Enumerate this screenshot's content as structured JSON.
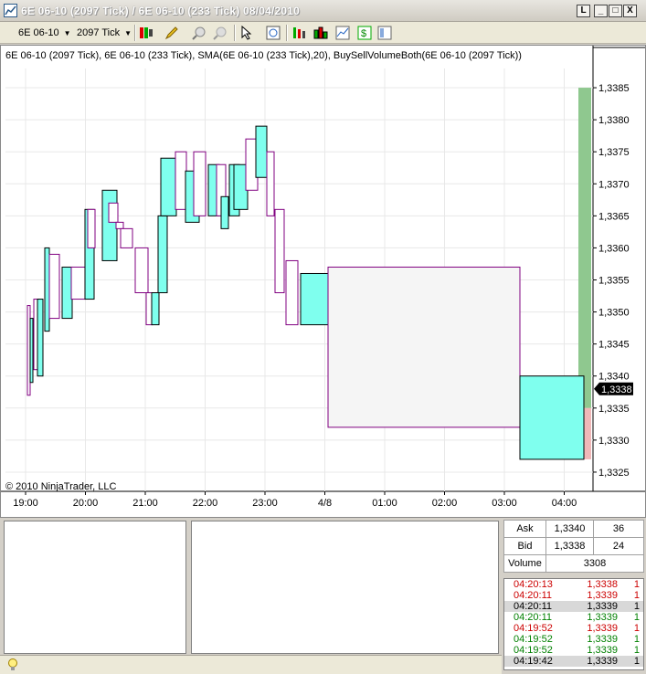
{
  "window": {
    "title": "6E 06-10 (2097 Tick) / 6E 06-10 (233 Tick)  08/04/2010",
    "buttons": {
      "link": "L",
      "minimize": "_",
      "maximize": "□",
      "close": "X"
    }
  },
  "toolbar": {
    "instrument": "6E 06-10",
    "interval": "2097 Tick",
    "icons": [
      "bar-type-icon",
      "drawing-pencil-icon",
      "zoom-in-icon",
      "zoom-out-icon",
      "cursor-pointer-icon",
      "crosshair-icon",
      "chart-properties-icon",
      "bar-chart-icon",
      "data-box-icon",
      "dollar-icon",
      "strategy-icon"
    ]
  },
  "chart": {
    "info_line": "6E 06-10 (2097 Tick), 6E 06-10 (233 Tick), SMA(6E 06-10 (233 Tick),20), BuySellVolumeBoth(6E 06-10 (2097 Tick))",
    "copyright": "© 2010 NinjaTrader, LLC",
    "last_price_label": "1,3338",
    "colors": {
      "up": "#7fffee",
      "down_fill": "#ffffff",
      "down_outline": "#800080",
      "volume": "#8fc88f",
      "volume_sell": "#f0b8b8"
    }
  },
  "chart_data": {
    "type": "candlestick",
    "y_ticks": [
      "1,3385",
      "1,3380",
      "1,3375",
      "1,3370",
      "1,3365",
      "1,3360",
      "1,3355",
      "1,3350",
      "1,3345",
      "1,3340",
      "1,3335",
      "1,3330",
      "1,3325"
    ],
    "x_ticks": [
      "19:00",
      "20:00",
      "21:00",
      "22:00",
      "23:00",
      "4/8",
      "01:00",
      "02:00",
      "03:00",
      "04:00"
    ],
    "ylim": [
      1.3322,
      1.3388
    ],
    "candles": [
      {
        "t": 0.0,
        "open": 1.3351,
        "close": 1.3337,
        "high": 1.3352,
        "low": 1.3337
      },
      {
        "t": 0.3,
        "open": 1.3339,
        "close": 1.3349,
        "high": 1.335,
        "low": 1.3339
      },
      {
        "t": 0.5,
        "open": 1.3352,
        "close": 1.3341,
        "high": 1.3352,
        "low": 1.334
      },
      {
        "t": 0.7,
        "open": 1.334,
        "close": 1.3352,
        "high": 1.3352,
        "low": 1.334
      },
      {
        "t": 1.1,
        "open": 1.3347,
        "close": 1.336,
        "high": 1.336,
        "low": 1.3347
      },
      {
        "t": 1.6,
        "open": 1.3359,
        "close": 1.3349,
        "high": 1.3359,
        "low": 1.3349
      },
      {
        "t": 2.1,
        "open": 1.3349,
        "close": 1.3357,
        "high": 1.3357,
        "low": 1.3349
      },
      {
        "t": 2.6,
        "open": 1.3357,
        "close": 1.3352,
        "high": 1.3357,
        "low": 1.3352
      },
      {
        "t": 3.1,
        "open": 1.3352,
        "close": 1.3366,
        "high": 1.3366,
        "low": 1.3352
      },
      {
        "t": 3.6,
        "open": 1.3366,
        "close": 1.336,
        "high": 1.3366,
        "low": 1.3358
      },
      {
        "t": 4.1,
        "open": 1.3358,
        "close": 1.3369,
        "high": 1.3369,
        "low": 1.3358
      },
      {
        "t": 4.6,
        "open": 1.3367,
        "close": 1.3364,
        "high": 1.3367,
        "low": 1.3364
      },
      {
        "t": 5.1,
        "open": 1.3364,
        "close": 1.3363,
        "high": 1.3364,
        "low": 1.3357
      },
      {
        "t": 5.6,
        "open": 1.3363,
        "close": 1.336,
        "high": 1.3364,
        "low": 1.3359
      },
      {
        "t": 6.1,
        "open": 1.336,
        "close": 1.3353,
        "high": 1.3363,
        "low": 1.3353
      },
      {
        "t": 6.6,
        "open": 1.3353,
        "close": 1.3348,
        "high": 1.3353,
        "low": 1.3348
      },
      {
        "t": 7.1,
        "open": 1.3348,
        "close": 1.3353,
        "high": 1.3353,
        "low": 1.3348
      },
      {
        "t": 7.6,
        "open": 1.3353,
        "close": 1.3365,
        "high": 1.3365,
        "low": 1.3353
      },
      {
        "t": 8.1,
        "open": 1.3365,
        "close": 1.3374,
        "high": 1.3375,
        "low": 1.3365
      },
      {
        "t": 8.6,
        "open": 1.3375,
        "close": 1.3366,
        "high": 1.3375,
        "low": 1.3366
      },
      {
        "t": 9.1,
        "open": 1.3364,
        "close": 1.3372,
        "high": 1.3372,
        "low": 1.3364
      },
      {
        "t": 9.6,
        "open": 1.3375,
        "close": 1.3365,
        "high": 1.3375,
        "low": 1.3365
      },
      {
        "t": 10.1,
        "open": 1.3365,
        "close": 1.3373,
        "high": 1.3373,
        "low": 1.3365
      },
      {
        "t": 10.6,
        "open": 1.3373,
        "close": 1.3365,
        "high": 1.3373,
        "low": 1.3363
      },
      {
        "t": 11.1,
        "open": 1.3363,
        "close": 1.3368,
        "high": 1.3368,
        "low": 1.3363
      },
      {
        "t": 11.5,
        "open": 1.3365,
        "close": 1.3373,
        "high": 1.3373,
        "low": 1.3365
      },
      {
        "t": 11.9,
        "open": 1.3366,
        "close": 1.3373,
        "high": 1.3373,
        "low": 1.3366
      },
      {
        "t": 12.4,
        "open": 1.3377,
        "close": 1.3369,
        "high": 1.3377,
        "low": 1.3369
      },
      {
        "t": 12.9,
        "open": 1.3371,
        "close": 1.3379,
        "high": 1.3379,
        "low": 1.3371
      },
      {
        "t": 13.4,
        "open": 1.3375,
        "close": 1.3365,
        "high": 1.3375,
        "low": 1.3365
      },
      {
        "t": 13.8,
        "open": 1.3366,
        "close": 1.3353,
        "high": 1.3366,
        "low": 1.3353
      },
      {
        "t": 14.4,
        "open": 1.3358,
        "close": 1.3348,
        "high": 1.3358,
        "low": 1.3348
      },
      {
        "t": 15.0,
        "open": 1.3348,
        "close": 1.3356,
        "high": 1.3356,
        "low": 1.3348
      },
      {
        "t": 16.0,
        "open": 1.3357,
        "close": 1.3332,
        "high": 1.3357,
        "low": 1.3332
      },
      {
        "t": 22.0,
        "open": 1.3327,
        "close": 1.334,
        "high": 1.334,
        "low": 1.3327
      }
    ],
    "volume_bar": {
      "buy_top": 1.3385,
      "sell_top": 1.3335
    }
  },
  "quote": {
    "ask_label": "Ask",
    "ask_price": "1,3340",
    "ask_size": "36",
    "bid_label": "Bid",
    "bid_price": "1,3338",
    "bid_size": "24",
    "volume_label": "Volume",
    "volume_value": "3308"
  },
  "time_sales": [
    {
      "time": "04:20:13",
      "price": "1,3338",
      "size": "1",
      "color": "#cc0000",
      "bg": "#ffffff"
    },
    {
      "time": "04:20:11",
      "price": "1,3339",
      "size": "1",
      "color": "#cc0000",
      "bg": "#ffffff"
    },
    {
      "time": "04:20:11",
      "price": "1,3339",
      "size": "1",
      "color": "#000000",
      "bg": "#d8d8d8"
    },
    {
      "time": "04:20:11",
      "price": "1,3339",
      "size": "1",
      "color": "#008000",
      "bg": "#ffffff"
    },
    {
      "time": "04:19:52",
      "price": "1,3339",
      "size": "1",
      "color": "#cc0000",
      "bg": "#ffffff"
    },
    {
      "time": "04:19:52",
      "price": "1,3339",
      "size": "1",
      "color": "#008000",
      "bg": "#ffffff"
    },
    {
      "time": "04:19:52",
      "price": "1,3339",
      "size": "1",
      "color": "#008000",
      "bg": "#ffffff"
    },
    {
      "time": "04:19:42",
      "price": "1,3339",
      "size": "1",
      "color": "#000000",
      "bg": "#d8d8d8"
    }
  ]
}
